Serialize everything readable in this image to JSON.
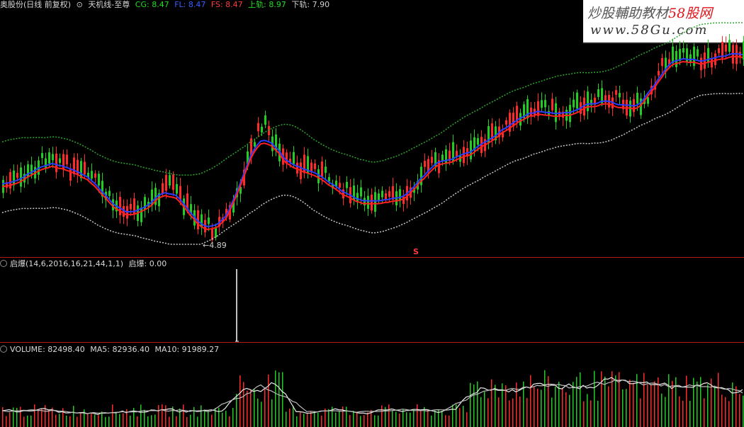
{
  "price_pane": {
    "stock_name": "奥股份(日线 前复权)",
    "indicator_name": "天机线-至尊",
    "fields": [
      {
        "label": "CG: 8.47",
        "color": "#22dd22"
      },
      {
        "label": "FL: 8.47",
        "color": "#3a5dff"
      },
      {
        "label": "FS: 8.47",
        "color": "#ff3b3b"
      },
      {
        "label": "上轨: 8.97",
        "color": "#22dd22"
      },
      {
        "label": "下轨: 7.90",
        "color": "#cfcfcf"
      }
    ],
    "low_marker": "4.89",
    "signal_marker": "S"
  },
  "qibao_pane": {
    "title": "启爆(14,6,2016,16,21,44,1,1)",
    "value_label": "启爆: 0.00"
  },
  "volume_pane": {
    "title": "VOLUME: 82498.40",
    "ma5": "MA5: 82936.40",
    "ma10": "MA10: 91989.27"
  },
  "watermark": {
    "line1_prefix": "炒股輔助教材",
    "line1_brand": "58股网",
    "line2": "www.58Gu.com"
  },
  "colors": {
    "up": "#ff2a2a",
    "down": "#22cc22",
    "upper_band": "#2fa52f",
    "lower_band": "#c8c8c8",
    "fast_line": "#ff2020",
    "slow_line": "#2a3cff",
    "separator": "#b01818"
  }
}
